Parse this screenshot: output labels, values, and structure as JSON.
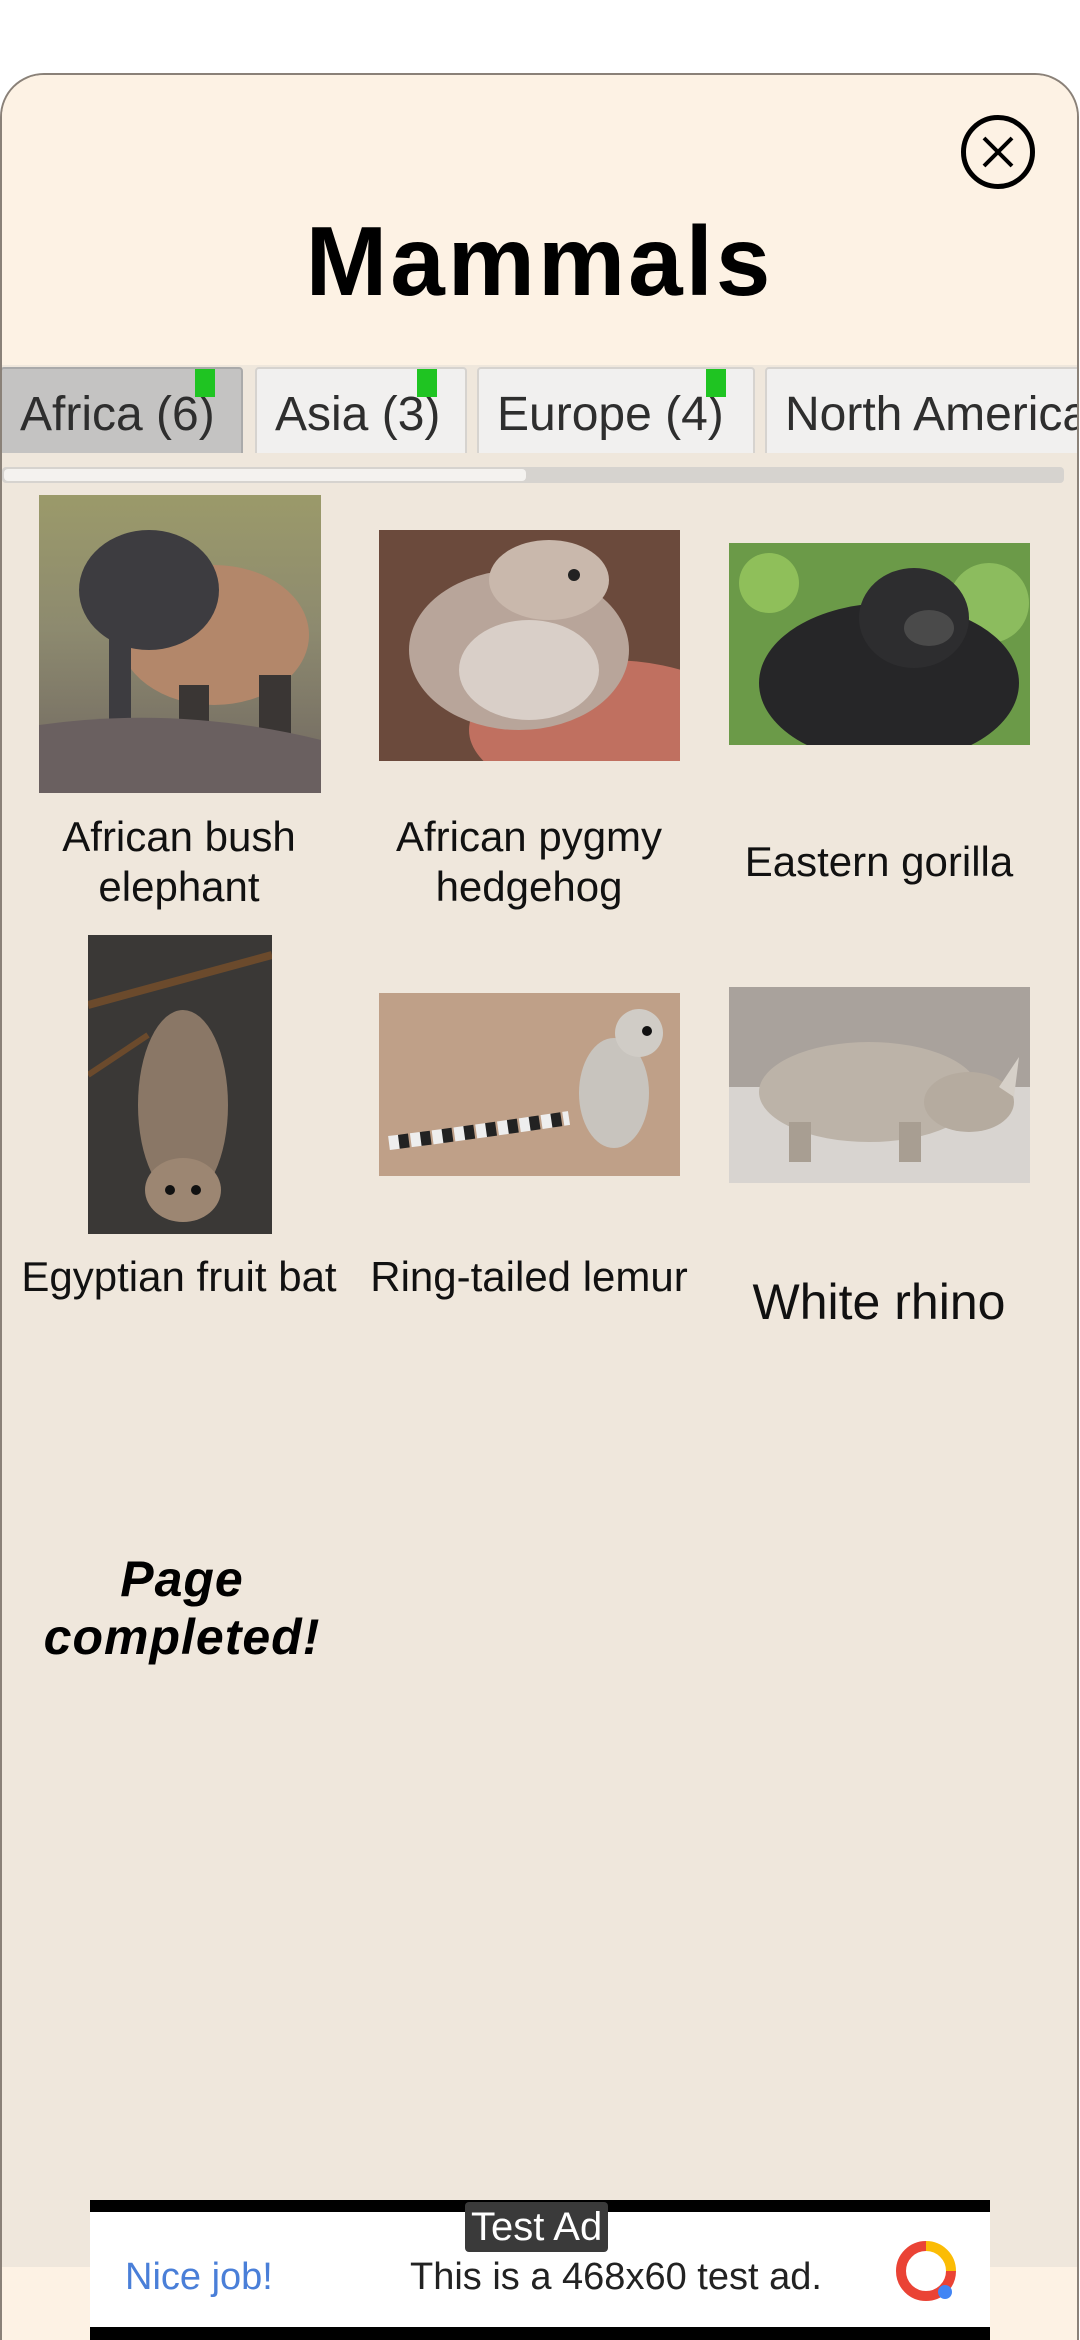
{
  "header": {
    "title": "Mammals"
  },
  "tabs": [
    {
      "label": "Africa (6)",
      "active": true
    },
    {
      "label": "Asia (3)",
      "active": false
    },
    {
      "label": "Europe (4)",
      "active": false
    },
    {
      "label": "North America",
      "active": false
    }
  ],
  "animals": [
    {
      "name": "African bush elephant"
    },
    {
      "name": "African pygmy hedgehog"
    },
    {
      "name": "Eastern gorilla"
    },
    {
      "name": "Egyptian fruit bat"
    },
    {
      "name": "Ring-tailed lemur"
    },
    {
      "name": "White rhino"
    }
  ],
  "status": {
    "completed": "Page completed!"
  },
  "ad": {
    "label": "Test Ad",
    "cta": "Nice job!",
    "text": "This is a 468x60 test ad."
  },
  "colors": {
    "header_bg": "#fdf2e4",
    "content_bg": "#efe7dc",
    "tab_marker": "#1fc422",
    "ad_cta": "#4a7fd8"
  },
  "icons": [
    "close-icon",
    "ad-logo-icon"
  ]
}
